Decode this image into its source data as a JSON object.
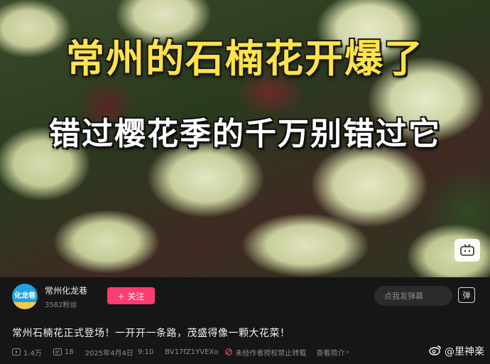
{
  "video": {
    "title": "常州的石楠花开爆了",
    "subtitle": "错过樱花季的千万别错过它"
  },
  "author": {
    "avatar_text": "化龙巷",
    "name": "常州化龙巷",
    "followers": "3582粉丝",
    "follow_label": "+ 关注"
  },
  "danmaku": {
    "placeholder": "点我发弹幕",
    "toggle_label": "弹"
  },
  "description": "常州石楠花正式登场！一开开一条路，茂盛得像一颗大花菜！",
  "meta": {
    "views": "1.4万",
    "danmaku_count": "18",
    "date": "2025年4月4日",
    "time": "9:10",
    "bvid": "BV17fZ1YVEXo",
    "warning": "未经作者授权禁止转载",
    "more": "查看简介"
  },
  "watermark": "@里神楽",
  "icons": {
    "tv": "tv-icon",
    "play": "play-count-icon",
    "danmaku": "danmaku-count-icon",
    "forbid": "forbid-icon",
    "weibo": "weibo-icon"
  },
  "colors": {
    "follow": "#ff3a71",
    "title": "#ffe34a",
    "background": "#161616"
  }
}
